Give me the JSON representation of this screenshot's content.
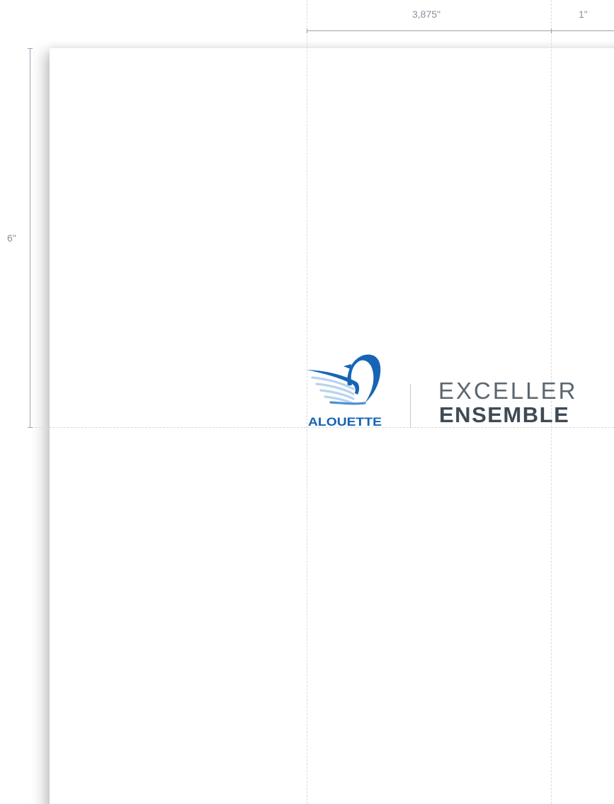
{
  "dimensions": {
    "width_label": "3,875\"",
    "margin_label": "1\"",
    "height_label": "6\""
  },
  "logo": {
    "brand": "ALOUETTE",
    "tagline_line1": "EXCELLER",
    "tagline_line2": "ENSEMBLE"
  },
  "colors": {
    "brand_blue": "#1665b5",
    "wing_light": "#b8d3ee",
    "tagline_grey": "#5b6670",
    "tagline_dark": "#3e4a55",
    "guide": "#d8dadd",
    "dimension": "#9aa3ad"
  }
}
